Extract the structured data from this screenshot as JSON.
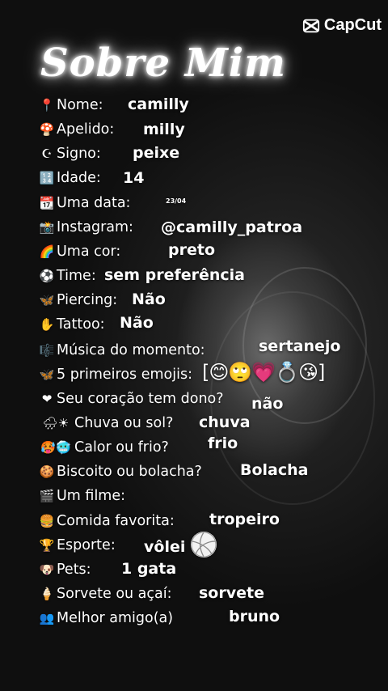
{
  "watermark": {
    "label": "CapCut"
  },
  "title": "Sobre Mim",
  "rows": [
    {
      "icon": "📍",
      "question": "Nome:",
      "answer": "camilly"
    },
    {
      "icon": "🍄",
      "question": "Apelido:",
      "answer": "milly"
    },
    {
      "icon": "☪",
      "question": "Signo:",
      "answer": "peixe"
    },
    {
      "icon": "🔢",
      "question": "Idade:",
      "answer": "14"
    },
    {
      "icon": "📆",
      "question": "Uma data:",
      "answer": "23/04"
    },
    {
      "icon": "📸",
      "question": "Instagram:",
      "answer": "@camilly_patroa"
    },
    {
      "icon": "🌈",
      "question": "Uma cor:",
      "answer": "preto"
    },
    {
      "icon": "⚽",
      "question": "Time:",
      "answer": "sem preferência"
    },
    {
      "icon": "🦋",
      "question": "Piercing:",
      "answer": "Não"
    },
    {
      "icon": "✋",
      "question": "Tattoo:",
      "answer": "Não"
    },
    {
      "icon": "🎼",
      "question": "Música do momento:",
      "answer": "sertanejo"
    },
    {
      "icon": "🦋",
      "question": "5 primeiros emojis:",
      "answer": "[😊🙄💗💍😘]"
    },
    {
      "icon": "❤",
      "question": "Seu coração tem dono?",
      "answer": "não"
    },
    {
      "icon": "🌧☀",
      "question": "Chuva ou sol?",
      "answer": "chuva"
    },
    {
      "icon": "🥵🥶",
      "question": "Calor ou frio?",
      "answer": "frio"
    },
    {
      "icon": "🍪",
      "question": "Biscoito ou bolacha?",
      "answer": "Bolacha"
    },
    {
      "icon": "🎬",
      "question": "Um filme:",
      "answer": ""
    },
    {
      "icon": "🍔",
      "question": "Comida favorita:",
      "answer": "tropeiro"
    },
    {
      "icon": "🏆",
      "question": "Esporte:",
      "answer": "vôlei"
    },
    {
      "icon": "🐶",
      "question": "Pets:",
      "answer": "1 gata"
    },
    {
      "icon": "🍦",
      "question": "Sorvete ou açaí:",
      "answer": "sorvete"
    },
    {
      "icon": "👥",
      "question": "Melhor amigo(a)",
      "answer": "bruno"
    }
  ]
}
